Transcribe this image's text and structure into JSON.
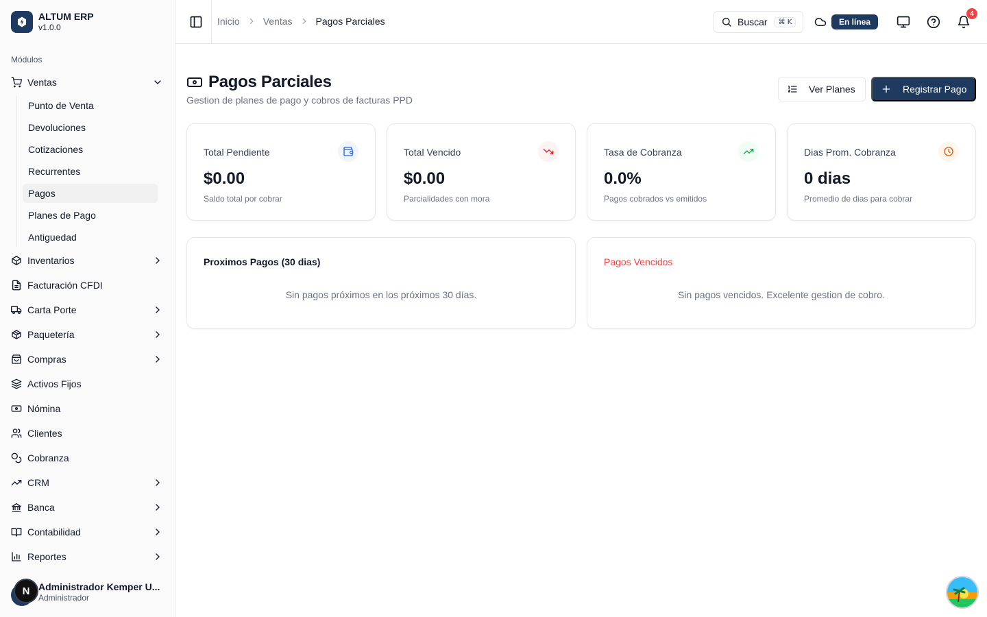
{
  "brand": {
    "name": "ALTUM ERP",
    "version": "v1.0.0"
  },
  "sidebar": {
    "section_label": "Módulos",
    "ventas": {
      "label": "Ventas",
      "items": [
        "Punto de Venta",
        "Devoluciones",
        "Cotizaciones",
        "Recurrentes",
        "Pagos",
        "Planes de Pago",
        "Antiguedad"
      ],
      "active": "Pagos"
    },
    "modules": [
      {
        "label": "Inventarios",
        "icon": "box-icon",
        "expandable": true
      },
      {
        "label": "Facturación CFDI",
        "icon": "file-text-icon",
        "expandable": false
      },
      {
        "label": "Carta Porte",
        "icon": "truck-icon",
        "expandable": true
      },
      {
        "label": "Paquetería",
        "icon": "package-icon",
        "expandable": true
      },
      {
        "label": "Compras",
        "icon": "shopping-bag-icon",
        "expandable": true
      },
      {
        "label": "Activos Fijos",
        "icon": "layers-icon",
        "expandable": false
      },
      {
        "label": "Nómina",
        "icon": "banknote-icon",
        "expandable": false
      },
      {
        "label": "Clientes",
        "icon": "users-icon",
        "expandable": false
      },
      {
        "label": "Cobranza",
        "icon": "coins-icon",
        "expandable": false
      },
      {
        "label": "CRM",
        "icon": "trending-up-icon",
        "expandable": true
      },
      {
        "label": "Banca",
        "icon": "bank-icon",
        "expandable": true
      },
      {
        "label": "Contabilidad",
        "icon": "book-open-icon",
        "expandable": true
      },
      {
        "label": "Reportes",
        "icon": "bar-chart-icon",
        "expandable": true
      }
    ],
    "user": {
      "initial": "N",
      "name": "Administrador Kemper U...",
      "role": "Administrador"
    }
  },
  "header": {
    "breadcrumbs": [
      "Inicio",
      "Ventas",
      "Pagos Parciales"
    ],
    "search_label": "Buscar",
    "search_shortcut": "⌘ K",
    "status": "En línea",
    "notifications_count": "4"
  },
  "page": {
    "title": "Pagos Parciales",
    "subtitle": "Gestion de planes de pago y cobros de facturas PPD",
    "btn_planes": "Ver Planes",
    "btn_registrar": "Registrar Pago"
  },
  "stats": [
    {
      "title": "Total Pendiente",
      "value": "$0.00",
      "sub": "Saldo total por cobrar",
      "icon": "wallet-icon"
    },
    {
      "title": "Total Vencido",
      "value": "$0.00",
      "sub": "Parcialidades con mora",
      "icon": "trending-down-icon"
    },
    {
      "title": "Tasa de Cobranza",
      "value": "0.0%",
      "sub": "Pagos cobrados vs emitidos",
      "icon": "trending-up-icon"
    },
    {
      "title": "Dias Prom. Cobranza",
      "value": "0 dias",
      "sub": "Promedio de dias para cobrar",
      "icon": "clock-icon"
    }
  ],
  "panels": {
    "proximos": {
      "title": "Proximos Pagos (30 dias)",
      "empty": "Sin pagos próximos en los próximos 30 días."
    },
    "vencidos": {
      "title": "Pagos Vencidos",
      "empty": "Sin pagos vencidos. Excelente gestion de cobro."
    }
  },
  "colors": {
    "primary": "#1e3a5f",
    "danger": "#ef4444",
    "success": "#16a34a",
    "warning": "#ea580c",
    "info": "#2563eb"
  }
}
